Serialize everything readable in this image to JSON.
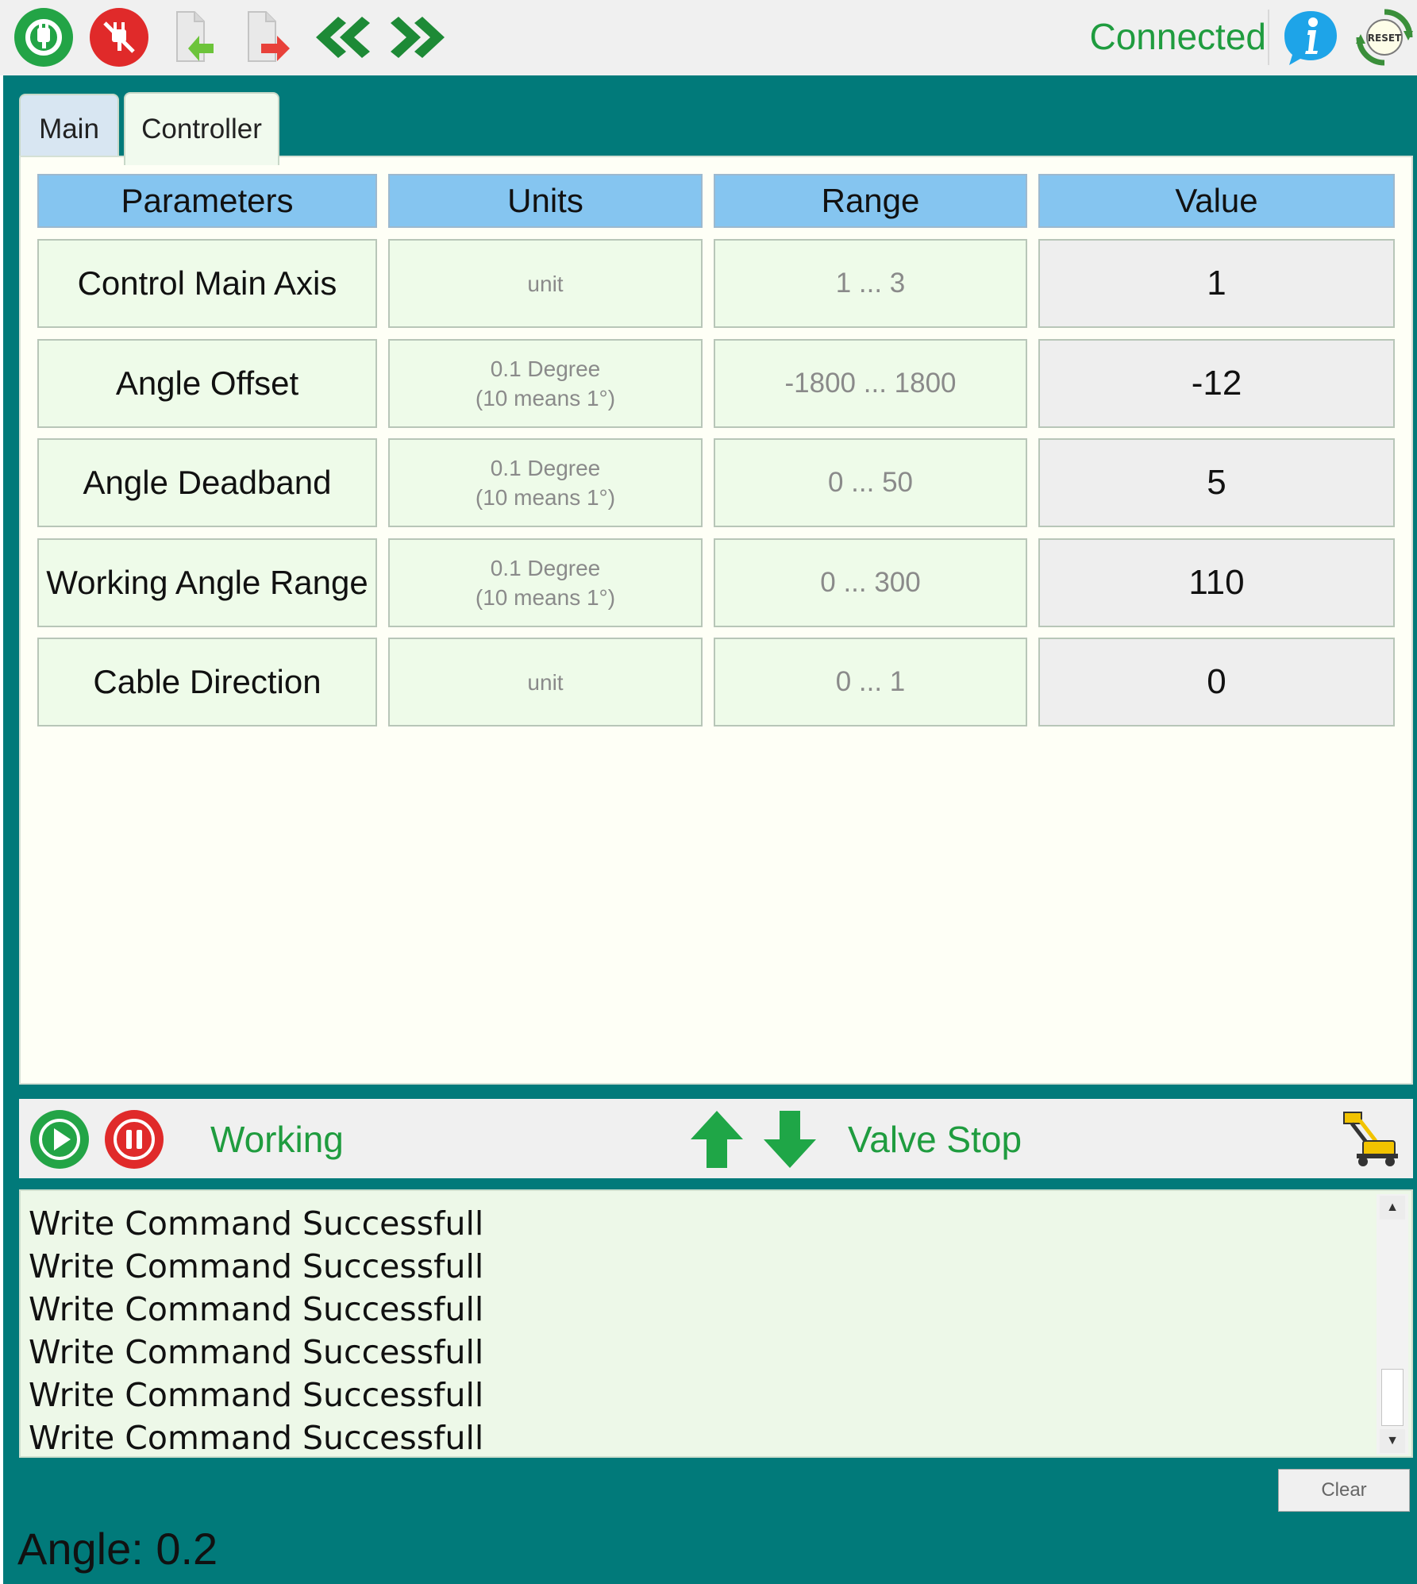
{
  "toolbar": {
    "connection_status": "Connected",
    "icons": [
      "connect-icon",
      "disconnect-icon",
      "read-icon",
      "write-icon",
      "previous-icon",
      "next-icon",
      "info-icon",
      "reset-icon"
    ],
    "reset_text": "RESET"
  },
  "tabs": [
    {
      "label": "Main",
      "active": false
    },
    {
      "label": "Controller",
      "active": true
    }
  ],
  "table": {
    "headers": [
      "Parameters",
      "Units",
      "Range",
      "Value"
    ],
    "rows": [
      {
        "param": "Control Main Axis",
        "units": [
          "unit"
        ],
        "range": "1 ... 3",
        "value": "1"
      },
      {
        "param": "Angle Offset",
        "units": [
          "0.1 Degree",
          "(10 means 1°)"
        ],
        "range": "-1800 ... 1800",
        "value": "-12"
      },
      {
        "param": "Angle Deadband",
        "units": [
          "0.1 Degree",
          "(10 means 1°)"
        ],
        "range": "0 ... 50",
        "value": "5"
      },
      {
        "param": "Working Angle Range",
        "units": [
          "0.1 Degree",
          "(10 means 1°)"
        ],
        "range": "0 ... 300",
        "value": "110"
      },
      {
        "param": "Cable Direction",
        "units": [
          "unit"
        ],
        "range": "0 ... 1",
        "value": "0"
      }
    ]
  },
  "status": {
    "state": "Working",
    "valve": "Valve Stop"
  },
  "log": {
    "lines": [
      "Write Command Successfull",
      "Write Command Successfull",
      "Write Command Successfull",
      "Write Command Successfull",
      "Write Command Successfull",
      "Write Command Successfull"
    ]
  },
  "footer": {
    "clear_label": "Clear",
    "angle": "Angle: 0.2"
  },
  "colors": {
    "accent_green": "#1f9c3f",
    "teal": "#017a7a",
    "header_blue": "#85c5f0",
    "stop_red": "#e02a2a",
    "info_blue": "#1ea4e8"
  }
}
